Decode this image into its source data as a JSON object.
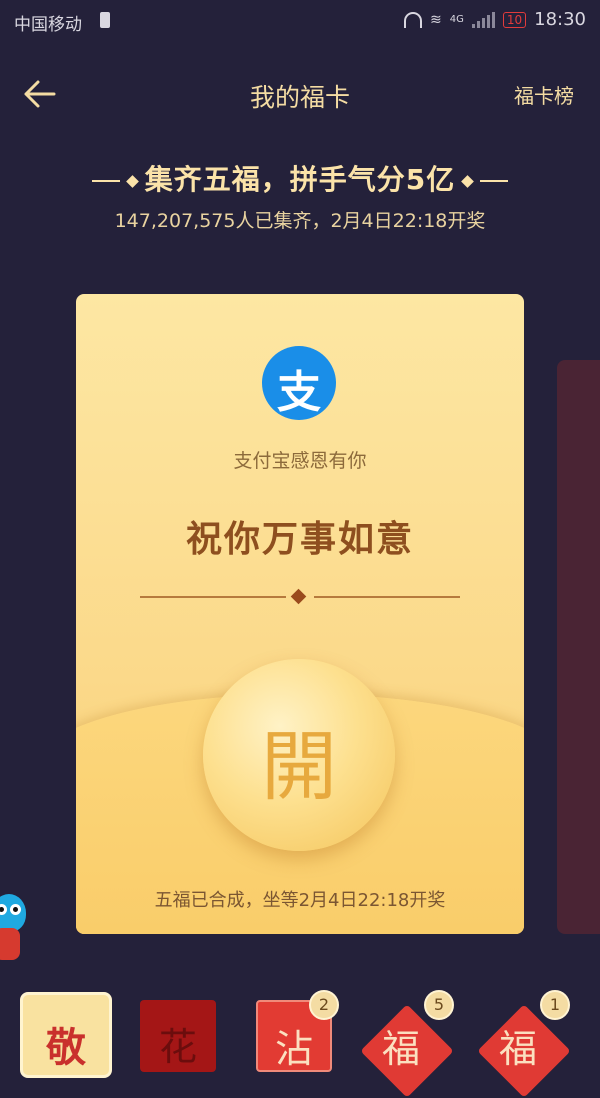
{
  "status_bar": {
    "carrier": "中国移动",
    "network": "4G",
    "battery": "10",
    "time": "18:30"
  },
  "header": {
    "title": "我的福卡",
    "rank_link": "福卡榜"
  },
  "banner": {
    "headline": "集齐五福，拼手气分5亿",
    "subline": "147,207,575人已集齐，2月4日22:18开奖"
  },
  "card": {
    "brand_glyph": "支",
    "thanks": "支付宝感恩有你",
    "wish": "祝你万事如意",
    "open_label": "開",
    "footnote": "五福已合成，坐等2月4日22:18开奖"
  },
  "fu_cards": [
    {
      "glyph": "敬",
      "selected": true
    },
    {
      "glyph": "花",
      "count": ""
    },
    {
      "glyph": "沾",
      "count": "2"
    },
    {
      "glyph": "福",
      "count": "5"
    },
    {
      "glyph": "福",
      "count": "1"
    }
  ],
  "colors": {
    "background": "#24213a",
    "gold_text": "#f4dca3",
    "card_gold": "#fbd98a",
    "alipay_blue": "#1a8ee8",
    "red": "#e03a34"
  }
}
